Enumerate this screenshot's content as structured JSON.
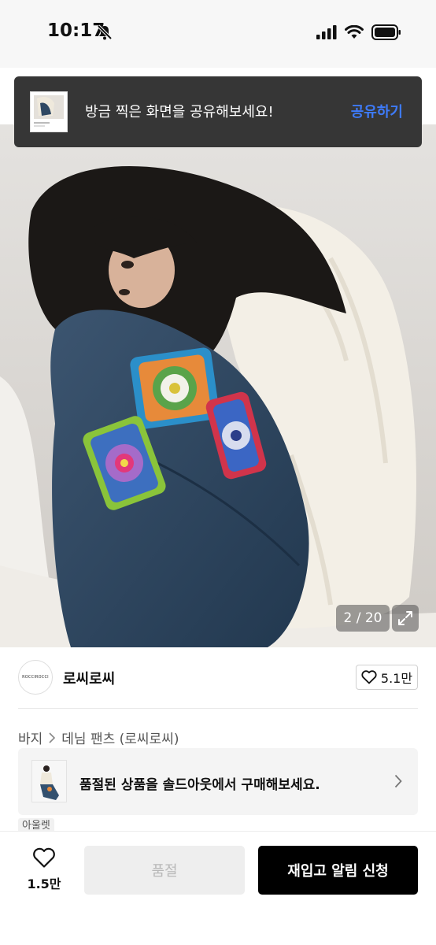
{
  "status_bar": {
    "time": "10:17"
  },
  "toast": {
    "message": "방금 찍은 화면을 공유해보세요!",
    "action": "공유하기"
  },
  "gallery": {
    "counter": "2 / 20"
  },
  "brand": {
    "name": "로씨로씨",
    "logo_text": "ROCCIROCCI",
    "likes": "5.1만"
  },
  "breadcrumb": {
    "category": "바지",
    "subcategory": "데님 팬츠 (로씨로씨)"
  },
  "soldout_banner": {
    "text": "품절된 상품을 솔드아웃에서 구매해보세요."
  },
  "tag": {
    "label": "아울렛"
  },
  "bottom_bar": {
    "like_count": "1.5만",
    "soldout_label": "품절",
    "restock_label": "재입고 알림 신청"
  },
  "colors": {
    "share_accent": "#3e7bfa",
    "primary_button": "#000000",
    "toast_bg": "#363636"
  }
}
